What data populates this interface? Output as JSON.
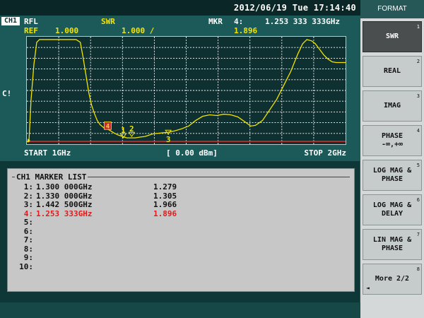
{
  "header": {
    "datetime": "2012/06/19 Tue 17:14:40"
  },
  "status": {
    "channel": "CH1",
    "measurement": "RFL",
    "format": "SWR",
    "marker_label": "MKR",
    "marker_index": "4:",
    "marker_freq": "1.253 333 333GHz",
    "ref_label": "REF",
    "ref_value": "1.000",
    "scale": "1.000 /",
    "marker_value": "1.896",
    "flag": "C!"
  },
  "sweep": {
    "start": "START 1GHz",
    "power": "[ 0.00 dBm]",
    "stop": "STOP 2GHz"
  },
  "marker_list": {
    "title": "CH1 MARKER LIST",
    "rows": [
      {
        "num": "1:",
        "freq": "1.300 000GHz",
        "value": "1.279"
      },
      {
        "num": "2:",
        "freq": "1.330 000GHz",
        "value": "1.305"
      },
      {
        "num": "3:",
        "freq": "1.442 500GHz",
        "value": "1.966"
      },
      {
        "num": "4:",
        "freq": "1.253 333GHz",
        "value": "1.896",
        "active": true
      },
      {
        "num": "5:",
        "freq": "",
        "value": ""
      },
      {
        "num": "6:",
        "freq": "",
        "value": ""
      },
      {
        "num": "7:",
        "freq": "",
        "value": ""
      },
      {
        "num": "8:",
        "freq": "",
        "value": ""
      },
      {
        "num": "9:",
        "freq": "",
        "value": ""
      },
      {
        "num": "10:",
        "freq": "",
        "value": ""
      }
    ]
  },
  "graph_markers": [
    "4",
    "1",
    "2",
    "3"
  ],
  "softkeys": {
    "title": "FORMAT",
    "keys": [
      {
        "label": "SWR",
        "num": "1",
        "selected": true
      },
      {
        "label": "REAL",
        "num": "2"
      },
      {
        "label": "IMAG",
        "num": "3"
      },
      {
        "label": "PHASE\n-∞,+∞",
        "num": "4"
      },
      {
        "label": "LOG MAG &\nPHASE",
        "num": "5"
      },
      {
        "label": "LOG MAG &\nDELAY",
        "num": "6"
      },
      {
        "label": "LIN MAG &\nPHASE",
        "num": "7"
      },
      {
        "label": "More 2/2",
        "num": "8",
        "arrow": "◄"
      }
    ]
  },
  "colors": {
    "trace": "#f2e400",
    "active_marker": "#e11b1b",
    "background": "#1c5a5a"
  }
}
